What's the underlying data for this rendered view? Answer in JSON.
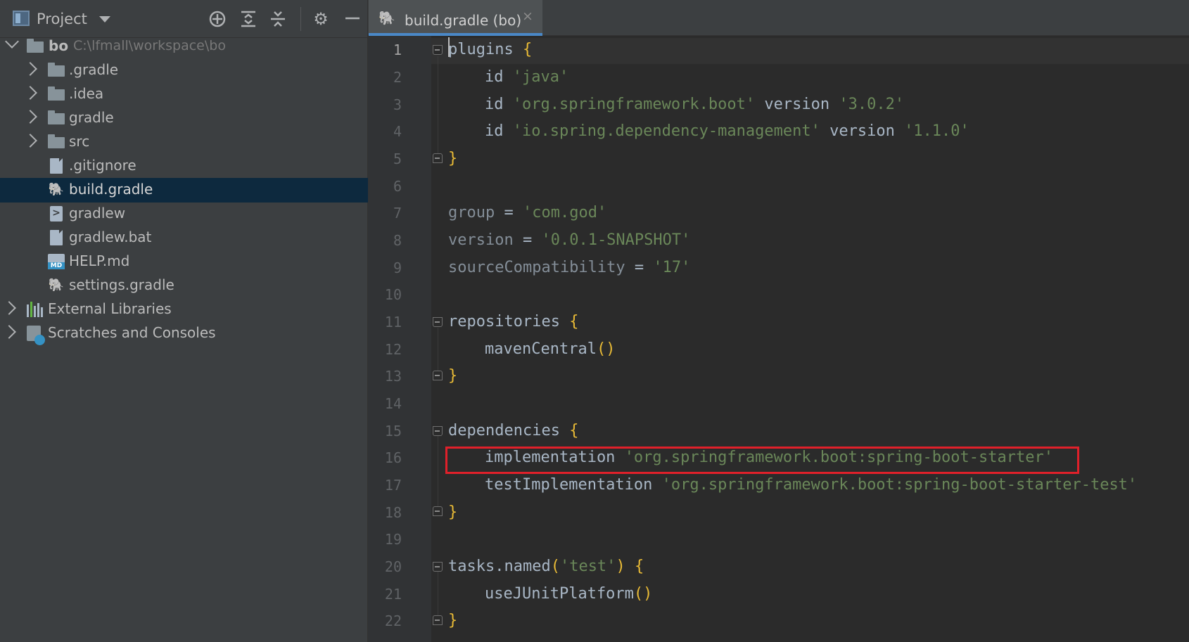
{
  "project_panel": {
    "title": "Project",
    "toolbar": [
      "locate-icon",
      "expand-all-icon",
      "collapse-all-icon",
      "gear-icon",
      "minimize-icon"
    ],
    "tree": [
      {
        "label": "bo",
        "path": "C:\\lfmall\\workspace\\bo",
        "icon": "module-folder-icon",
        "expanded": true
      },
      {
        "label": ".gradle",
        "icon": "folder-icon"
      },
      {
        "label": ".idea",
        "icon": "folder-icon"
      },
      {
        "label": "gradle",
        "icon": "folder-icon"
      },
      {
        "label": "src",
        "icon": "folder-icon"
      },
      {
        "label": ".gitignore",
        "icon": "gitignore-file-icon"
      },
      {
        "label": "build.gradle",
        "icon": "gradle-file-icon",
        "selected": true
      },
      {
        "label": "gradlew",
        "icon": "shell-script-icon"
      },
      {
        "label": "gradlew.bat",
        "icon": "bat-file-icon"
      },
      {
        "label": "HELP.md",
        "icon": "markdown-file-icon"
      },
      {
        "label": "settings.gradle",
        "icon": "gradle-file-icon"
      },
      {
        "label": "External Libraries",
        "icon": "libraries-icon"
      },
      {
        "label": "Scratches and Consoles",
        "icon": "scratches-icon"
      }
    ]
  },
  "editor": {
    "tab": {
      "label": "build.gradle (bo)",
      "close": "×"
    },
    "current_line": 1,
    "line_numbers": [
      "1",
      "2",
      "3",
      "4",
      "5",
      "6",
      "7",
      "8",
      "9",
      "10",
      "11",
      "12",
      "13",
      "14",
      "15",
      "16",
      "17",
      "18",
      "19",
      "20",
      "21",
      "22"
    ],
    "code": {
      "l1_kw": "plugins",
      "l2_id": "id",
      "l2_s": "'java'",
      "l3_id": "id",
      "l3_s": "'org.springframework.boot'",
      "l3_v": "version",
      "l3_vs": "'3.0.2'",
      "l4_id": "id",
      "l4_s": "'io.spring.dependency-management'",
      "l4_v": "version",
      "l4_vs": "'1.1.0'",
      "l7_p": "group",
      "l7_s": "'com.god'",
      "l8_p": "version",
      "l8_s": "'0.0.1-SNAPSHOT'",
      "l9_p": "sourceCompatibility",
      "l9_s": "'17'",
      "l11_kw": "repositories",
      "l12_fn": "mavenCentral",
      "l15_kw": "dependencies",
      "l16_fn": "implementation",
      "l16_s": "'org.springframework.boot:spring-boot-starter'",
      "l17_fn": "testImplementation",
      "l17_s": "'org.springframework.boot:spring-boot-starter-test'",
      "l20_a": "tasks.named",
      "l20_s": "'test'",
      "l21_fn": "useJUnitPlatform"
    }
  },
  "colors": {
    "panel_bg": "#3c3f41",
    "editor_bg": "#2b2b2b",
    "selection": "#0d293e",
    "tab_accent": "#4a88c7",
    "string": "#6a8759",
    "brace": "#e8ba36",
    "highlight_box": "#e0202a"
  }
}
